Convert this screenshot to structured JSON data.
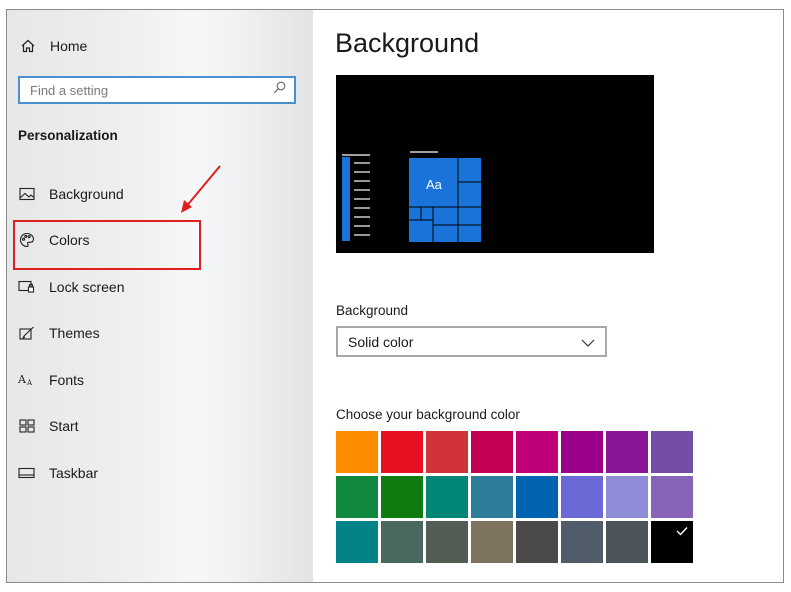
{
  "sidebar": {
    "home_label": "Home",
    "search_placeholder": "Find a setting",
    "section_title": "Personalization",
    "items": [
      {
        "label": "Background",
        "icon": "image-icon"
      },
      {
        "label": "Colors",
        "icon": "palette-icon"
      },
      {
        "label": "Lock screen",
        "icon": "lock-screen-icon"
      },
      {
        "label": "Themes",
        "icon": "themes-icon"
      },
      {
        "label": "Fonts",
        "icon": "fonts-icon"
      },
      {
        "label": "Start",
        "icon": "start-icon"
      },
      {
        "label": "Taskbar",
        "icon": "taskbar-icon"
      }
    ],
    "highlighted_item": "Colors"
  },
  "main": {
    "title": "Background",
    "preview": {
      "tile_text": "Aa",
      "accent": "#1a73d9"
    },
    "background_label": "Background",
    "background_value": "Solid color",
    "color_picker_label": "Choose your background color",
    "colors": [
      "#ff8c00",
      "#e81123",
      "#d13438",
      "#c30052",
      "#bf0077",
      "#9a0089",
      "#881798",
      "#744da9",
      "#10893e",
      "#107c10",
      "#018574",
      "#2d7d9a",
      "#0063b1",
      "#6b69d6",
      "#8e8cd8",
      "#8764b8",
      "#038387",
      "#486860",
      "#525e54",
      "#7e735f",
      "#4c4a48",
      "#515c6b",
      "#4a5459",
      "#000000"
    ],
    "selected_color": "#000000"
  },
  "annotation_color": "#e02020"
}
